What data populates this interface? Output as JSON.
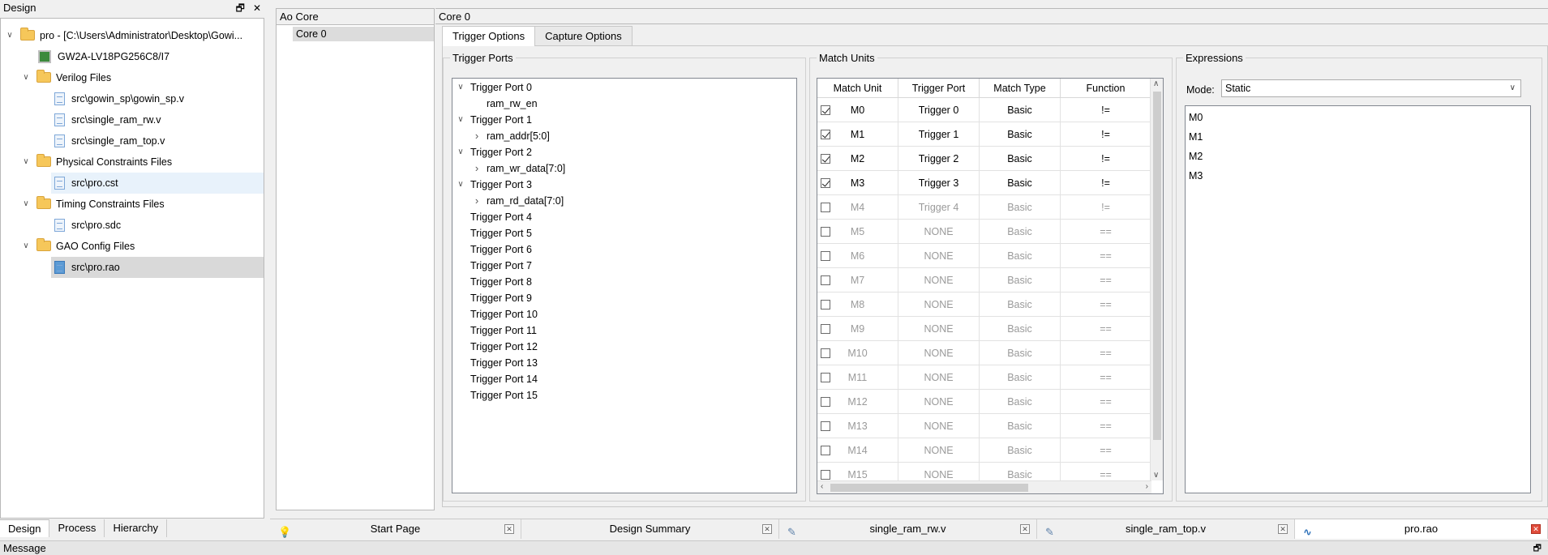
{
  "design_pane": {
    "title": "Design",
    "tree": {
      "project": "pro - [C:\\Users\\Administrator\\Desktop\\Gowi...",
      "device": "GW2A-LV18PG256C8/I7",
      "groups": [
        {
          "label": "Verilog Files",
          "files": [
            "src\\gowin_sp\\gowin_sp.v",
            "src\\single_ram_rw.v",
            "src\\single_ram_top.v"
          ]
        },
        {
          "label": "Physical Constraints Files",
          "files": [
            "src\\pro.cst"
          ]
        },
        {
          "label": "Timing Constraints Files",
          "files": [
            "src\\pro.sdc"
          ]
        },
        {
          "label": "GAO Config Files",
          "files": [
            "src\\pro.rao"
          ]
        }
      ]
    },
    "bottom_tabs": [
      "Design",
      "Process",
      "Hierarchy"
    ]
  },
  "ao_core": {
    "header": "Ao Core",
    "items": [
      "Core 0"
    ]
  },
  "core_panel": {
    "header": "Core 0",
    "tabs": [
      "Trigger Options",
      "Capture Options"
    ],
    "trigger_ports": {
      "title": "Trigger Ports",
      "rows": [
        {
          "label": "Trigger Port 0",
          "child": "ram_rw_en",
          "child_expandable": false
        },
        {
          "label": "Trigger Port 1",
          "child": "ram_addr[5:0]",
          "child_expandable": true
        },
        {
          "label": "Trigger Port 2",
          "child": "ram_wr_data[7:0]",
          "child_expandable": true
        },
        {
          "label": "Trigger Port 3",
          "child": "ram_rd_data[7:0]",
          "child_expandable": true
        },
        {
          "label": "Trigger Port 4"
        },
        {
          "label": "Trigger Port 5"
        },
        {
          "label": "Trigger Port 6"
        },
        {
          "label": "Trigger Port 7"
        },
        {
          "label": "Trigger Port 8"
        },
        {
          "label": "Trigger Port 9"
        },
        {
          "label": "Trigger Port 10"
        },
        {
          "label": "Trigger Port 11"
        },
        {
          "label": "Trigger Port 12"
        },
        {
          "label": "Trigger Port 13"
        },
        {
          "label": "Trigger Port 14"
        },
        {
          "label": "Trigger Port 15"
        }
      ]
    },
    "match_units": {
      "title": "Match Units",
      "columns": [
        "Match Unit",
        "Trigger Port",
        "Match Type",
        "Function"
      ],
      "rows": [
        {
          "checked": true,
          "unit": "M0",
          "port": "Trigger 0",
          "type": "Basic",
          "func": "!="
        },
        {
          "checked": true,
          "unit": "M1",
          "port": "Trigger 1",
          "type": "Basic",
          "func": "!="
        },
        {
          "checked": true,
          "unit": "M2",
          "port": "Trigger 2",
          "type": "Basic",
          "func": "!="
        },
        {
          "checked": true,
          "unit": "M3",
          "port": "Trigger 3",
          "type": "Basic",
          "func": "!="
        },
        {
          "checked": false,
          "unit": "M4",
          "port": "Trigger 4",
          "type": "Basic",
          "func": "!="
        },
        {
          "checked": false,
          "unit": "M5",
          "port": "NONE",
          "type": "Basic",
          "func": "=="
        },
        {
          "checked": false,
          "unit": "M6",
          "port": "NONE",
          "type": "Basic",
          "func": "=="
        },
        {
          "checked": false,
          "unit": "M7",
          "port": "NONE",
          "type": "Basic",
          "func": "=="
        },
        {
          "checked": false,
          "unit": "M8",
          "port": "NONE",
          "type": "Basic",
          "func": "=="
        },
        {
          "checked": false,
          "unit": "M9",
          "port": "NONE",
          "type": "Basic",
          "func": "=="
        },
        {
          "checked": false,
          "unit": "M10",
          "port": "NONE",
          "type": "Basic",
          "func": "=="
        },
        {
          "checked": false,
          "unit": "M11",
          "port": "NONE",
          "type": "Basic",
          "func": "=="
        },
        {
          "checked": false,
          "unit": "M12",
          "port": "NONE",
          "type": "Basic",
          "func": "=="
        },
        {
          "checked": false,
          "unit": "M13",
          "port": "NONE",
          "type": "Basic",
          "func": "=="
        },
        {
          "checked": false,
          "unit": "M14",
          "port": "NONE",
          "type": "Basic",
          "func": "=="
        },
        {
          "checked": false,
          "unit": "M15",
          "port": "NONE",
          "type": "Basic",
          "func": "=="
        }
      ]
    },
    "expressions": {
      "title": "Expressions",
      "mode_label": "Mode:",
      "mode_value": "Static",
      "lines": [
        "M0",
        "M1",
        "M2",
        "M3"
      ]
    }
  },
  "doc_tabs": [
    {
      "label": "Start Page",
      "icon": "lightbulb-icon",
      "active": false
    },
    {
      "label": "Design Summary",
      "icon": "",
      "active": false
    },
    {
      "label": "single_ram_rw.v",
      "icon": "edit-file-icon",
      "active": false
    },
    {
      "label": "single_ram_top.v",
      "icon": "edit-file-icon",
      "active": false
    },
    {
      "label": "pro.rao",
      "icon": "waveform-icon",
      "active": true
    }
  ],
  "message_bar": {
    "title": "Message"
  },
  "colors": {
    "accent": "#5b9bd5",
    "folder": "#f6c75a",
    "close_active": "#e04b3a"
  }
}
